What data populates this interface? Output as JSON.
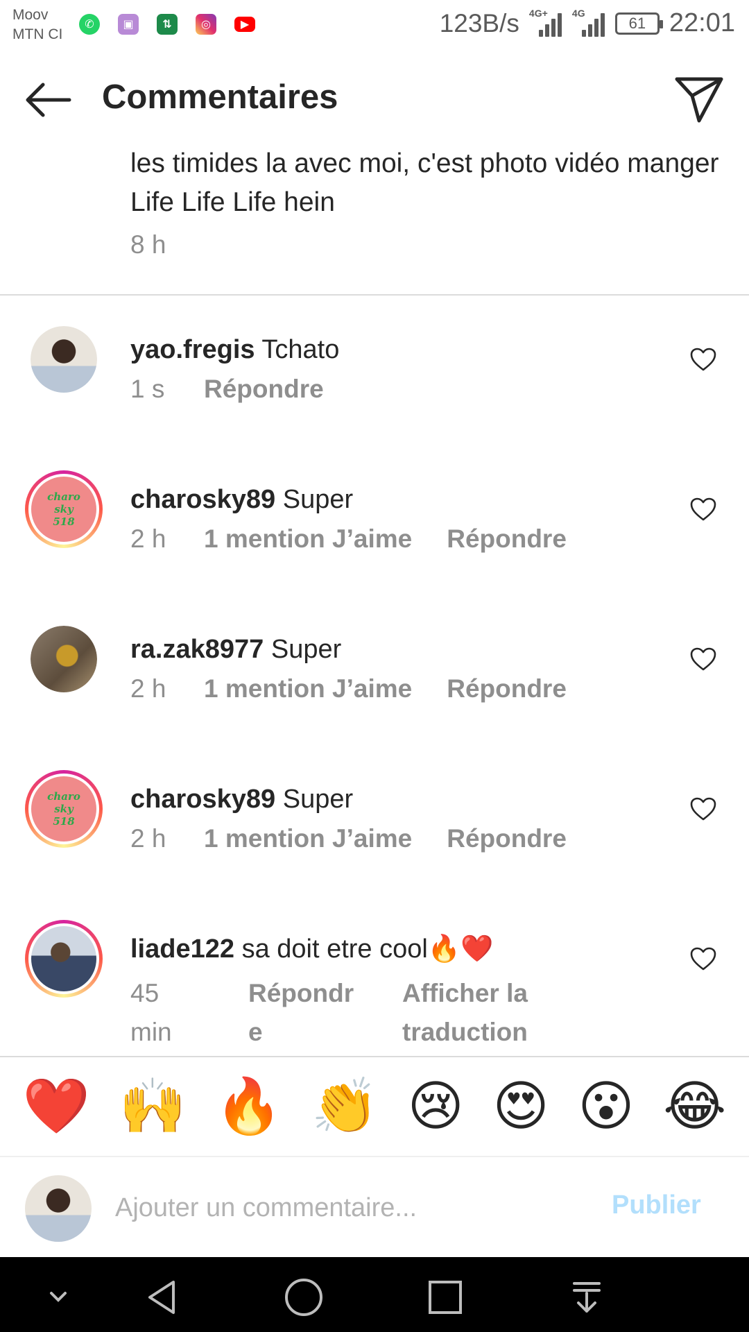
{
  "status_bar": {
    "carrier_1": "Moov",
    "carrier_2": "MTN CI",
    "notification_icons": [
      "whatsapp-icon",
      "gallery-icon",
      "data-sync-icon",
      "instagram-icon",
      "youtube-icon"
    ],
    "net_rate": "123B/s",
    "signal_1_label": "4G+",
    "signal_2_label": "4G",
    "battery": "61",
    "time": "22:01"
  },
  "header": {
    "title": "Commentaires",
    "back_icon": "arrow-left-icon",
    "share_icon": "paper-plane-icon"
  },
  "caption": {
    "text": "les timides la avec moi, c'est photo vidéo manger Life Life Life hein",
    "time": "8 h"
  },
  "comments": [
    {
      "username": "yao.fregis",
      "text": "Tchato",
      "time": "1 s",
      "likes": "",
      "reply": "Répondre"
    },
    {
      "username": "charosky89",
      "text": "Super",
      "time": "2 h",
      "likes": "1 mention J’aime",
      "reply": "Répondre",
      "avatar_text": [
        "charo",
        "sky",
        "518"
      ]
    },
    {
      "username": "ra.zak8977",
      "text": "Super",
      "time": "2 h",
      "likes": "1 mention J’aime",
      "reply": "Répondre"
    },
    {
      "username": "charosky89",
      "text": "Super",
      "time": "2 h",
      "likes": "1 mention J’aime",
      "reply": "Répondre",
      "avatar_text": [
        "charo",
        "sky",
        "518"
      ]
    },
    {
      "username": "liade122",
      "text": "sa doit etre cool🔥❤️",
      "time_1": "45",
      "time_2": "min",
      "reply_1": "Répondr",
      "reply_2": "e",
      "translate_1": "Afficher la",
      "translate_2": "traduction"
    }
  ],
  "emoji_bar": [
    "❤️",
    "🙌",
    "🔥",
    "👏",
    "😢",
    "😍",
    "😮",
    "😂"
  ],
  "composer": {
    "placeholder": "Ajouter un commentaire...",
    "publish": "Publier"
  },
  "colors": {
    "text": "#262626",
    "secondary": "#8e8e8e",
    "publish_disabled": "#b2dffc",
    "divider": "#dbdbdb",
    "navbar": "#000000"
  },
  "nav_bar": [
    "chevron-down-icon",
    "back-triangle-icon",
    "home-circle-icon",
    "recents-square-icon",
    "notification-pull-icon"
  ]
}
